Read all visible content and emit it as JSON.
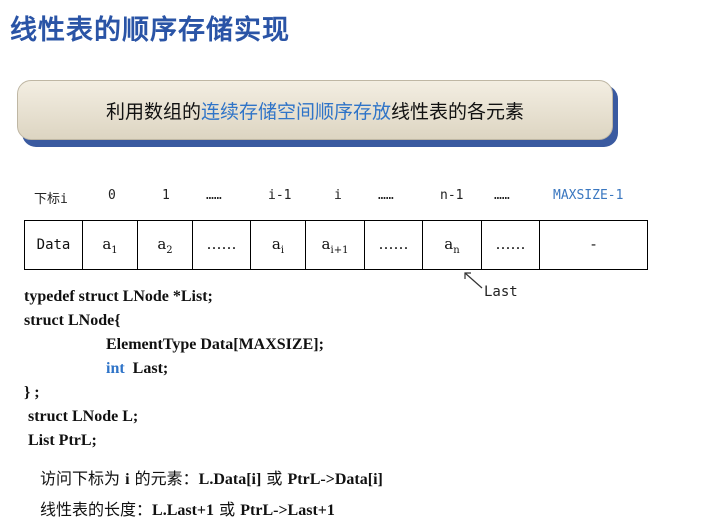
{
  "title": "线性表的顺序存储实现",
  "banner": {
    "pre": "利用数组的",
    "highlight": "连续存储空间顺序存放",
    "post": "线性表的各元素"
  },
  "index_row": {
    "label": "下标i",
    "items": [
      "0",
      "1",
      "……",
      "i-1",
      "i",
      "……",
      "n-1",
      "……",
      "MAXSIZE-1"
    ]
  },
  "array_row": {
    "label": "Data",
    "cells": [
      {
        "base": "a",
        "sub": "1"
      },
      {
        "base": "a",
        "sub": "2"
      },
      {
        "base": "……",
        "sub": ""
      },
      {
        "base": "a",
        "sub": "i"
      },
      {
        "base": "a",
        "sub": "i+1"
      },
      {
        "base": "……",
        "sub": ""
      },
      {
        "base": "a",
        "sub": "n"
      },
      {
        "base": "……",
        "sub": ""
      },
      {
        "base": "-",
        "sub": ""
      }
    ]
  },
  "last_pointer_label": "Last",
  "code": {
    "line1": "typedef struct LNode *List;",
    "line2": "struct LNode{",
    "line3": "ElementType  Data[MAXSIZE];",
    "line4_kw": "int",
    "line4_rest": "Last;",
    "line5": "} ;",
    "line6": "struct LNode L;",
    "line7": "List  PtrL;"
  },
  "notes": {
    "access_prefix": "访问下标为",
    "access_i": "i",
    "access_mid": "的元素：",
    "access_expr1": "L.Data[i]",
    "or1": "或",
    "access_expr2": "PtrL->Data[i]",
    "length_prefix": "线性表的长度：",
    "length_expr1": "L.Last+1",
    "or2": "或",
    "length_expr2": "PtrL->Last+1"
  }
}
